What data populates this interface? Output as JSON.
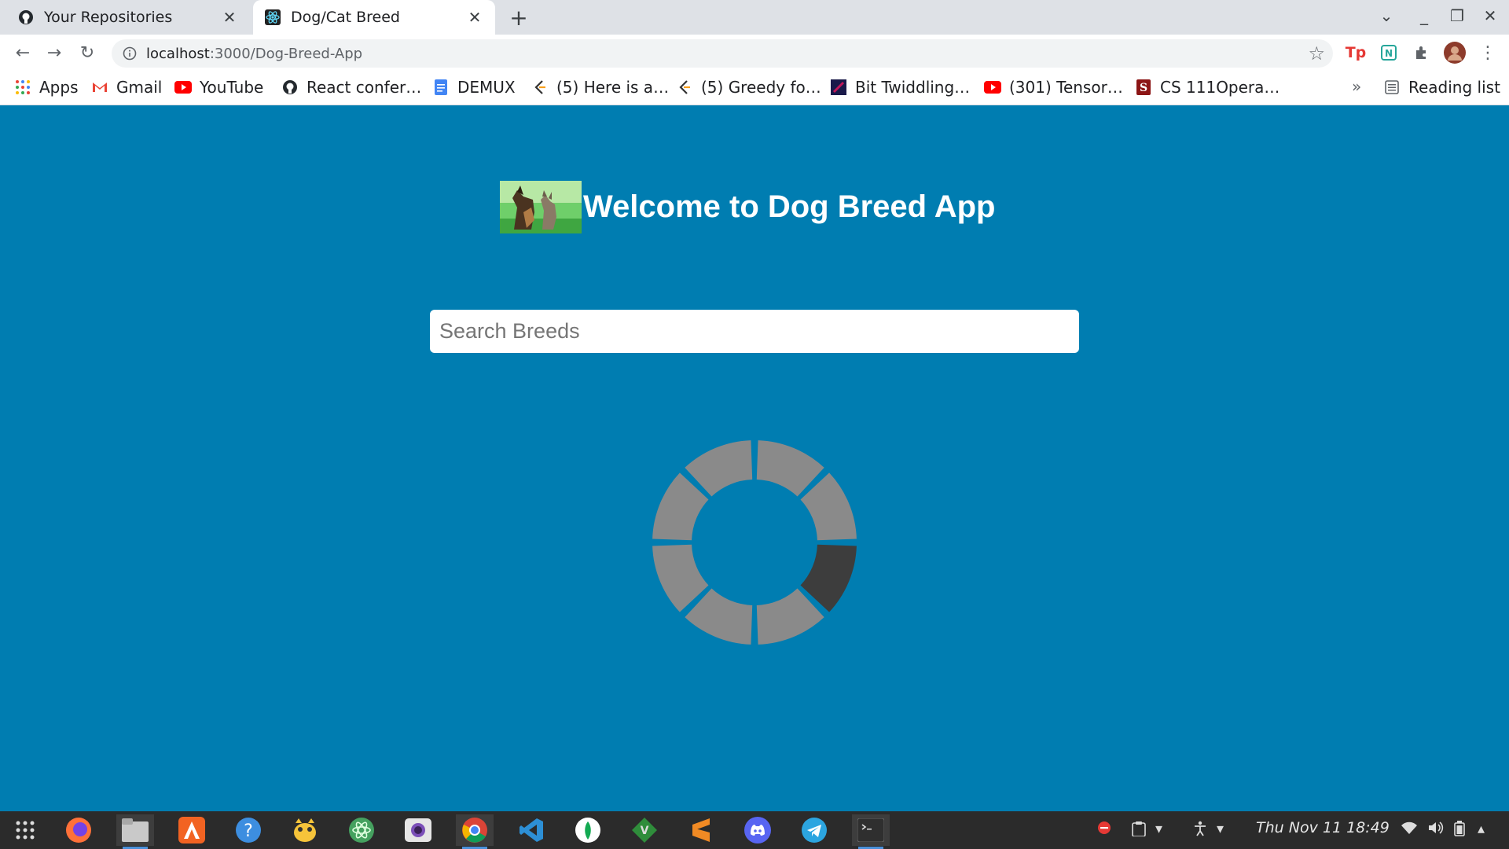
{
  "browser": {
    "tabs": [
      {
        "title": "Your Repositories",
        "icon": "github-icon",
        "active": false
      },
      {
        "title": "Dog/Cat Breed",
        "icon": "react-icon",
        "active": true
      }
    ],
    "address": {
      "host": "localhost",
      "path": ":3000/Dog-Breed-App"
    },
    "bookmarks": [
      {
        "label": "Apps",
        "icon": "apps-grid-icon"
      },
      {
        "label": "Gmail",
        "icon": "gmail-icon"
      },
      {
        "label": "YouTube",
        "icon": "youtube-icon"
      },
      {
        "label": "React confer…",
        "icon": "github-icon"
      },
      {
        "label": "DEMUX",
        "icon": "docs-icon"
      },
      {
        "label": "(5) Here is a…",
        "icon": "leetcode-icon"
      },
      {
        "label": "(5) Greedy fo…",
        "icon": "leetcode-icon"
      },
      {
        "label": "Bit Twiddling…",
        "icon": "page-icon"
      },
      {
        "label": "(301) Tensor…",
        "icon": "youtube-icon"
      },
      {
        "label": "CS 111Opera…",
        "icon": "stanford-icon"
      }
    ],
    "overflow_label": "»",
    "reading_list_label": "Reading list",
    "new_tab_label": "+",
    "close_label": "✕"
  },
  "page": {
    "heading": "Welcome to Dog Breed App",
    "search_placeholder": "Search Breeds",
    "search_value": "",
    "loading_segments": 8,
    "loading_active_segment": 2
  },
  "colors": {
    "page_background": "#007db1",
    "spinner_segment": "#8a8a8a",
    "spinner_active": "#3d3d3d"
  },
  "taskbar": {
    "apps": [
      "app-grid-icon",
      "firefox-icon",
      "files-icon",
      "app-store-icon",
      "help-icon",
      "pycharm-icon",
      "atom-icon",
      "camera-icon",
      "chrome-icon",
      "vscode-icon",
      "mongodb-icon",
      "vim-icon",
      "sublime-icon",
      "discord-icon",
      "telegram-icon",
      "terminal-icon"
    ],
    "clock": "Thu Nov 11  18:49"
  }
}
